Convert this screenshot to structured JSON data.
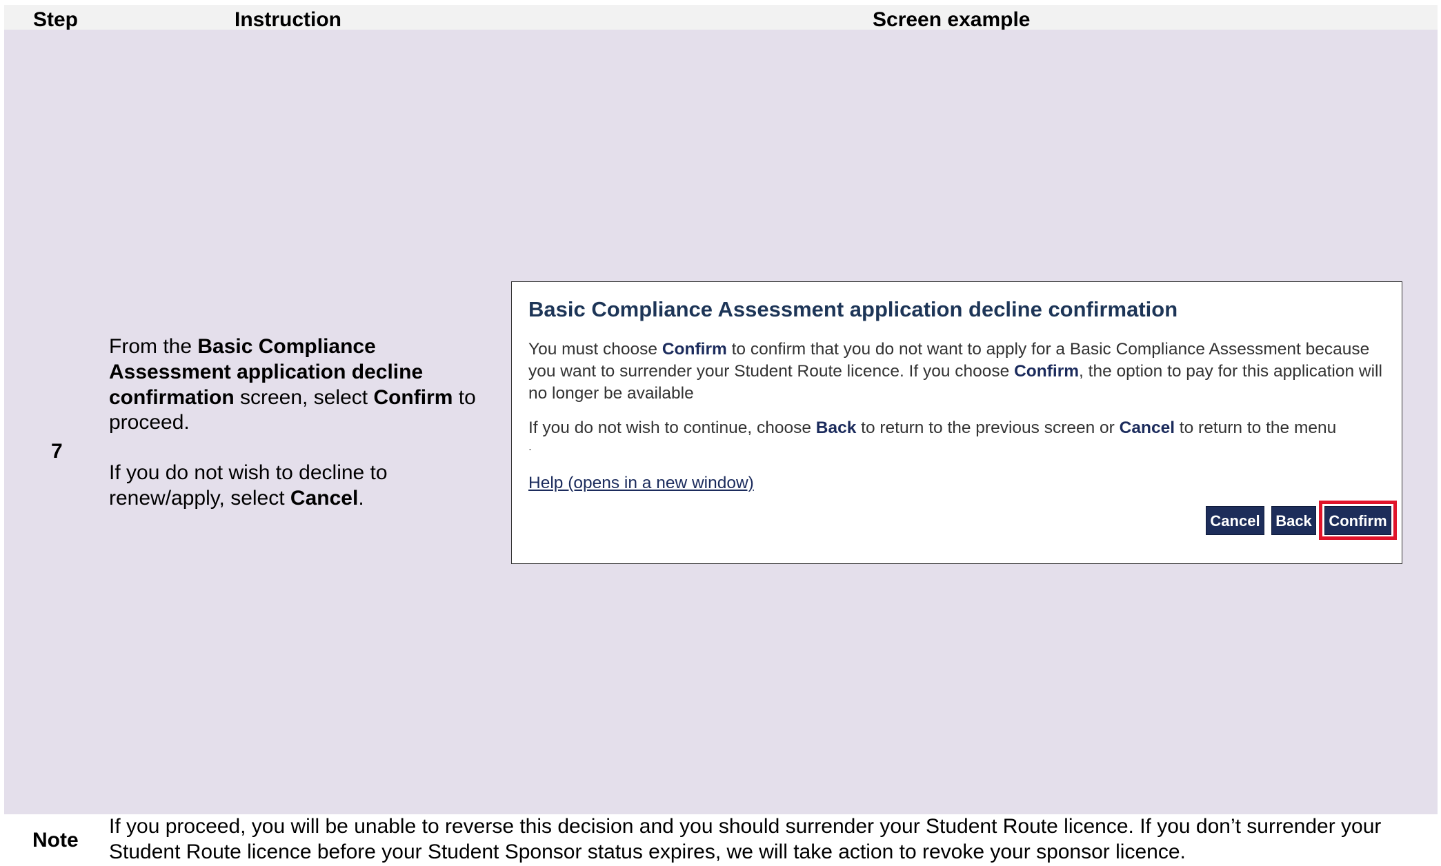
{
  "table": {
    "headers": {
      "step": "Step",
      "instruction": "Instruction",
      "screen": "Screen example"
    }
  },
  "row": {
    "step_number": "7",
    "instruction": {
      "p1_prefix": "From the ",
      "p1_bold": "Basic Compliance Assessment application decline confirmation",
      "p1_mid": " screen, select ",
      "p1_bold2": "Confirm",
      "p1_suffix": " to proceed.",
      "p2_prefix": "If you do not wish to decline to renew/apply, select ",
      "p2_bold": "Cancel",
      "p2_suffix": "."
    }
  },
  "dialog": {
    "title": "Basic Compliance Assessment application decline confirmation",
    "p1_a": "You must choose ",
    "p1_b": "Confirm",
    "p1_c": " to confirm that you do not want to apply for a Basic Compliance Assessment because you want to surrender your Student Route licence. If you choose ",
    "p1_d": "Confirm",
    "p1_e": ", the option to pay for this application will no longer be available",
    "p2_a": "If you do not wish to continue, choose ",
    "p2_b": "Back",
    "p2_c": " to return to the previous screen or ",
    "p2_d": "Cancel",
    "p2_e": " to return to the menu",
    "dot": ".",
    "help_link": "Help (opens in a new window)",
    "buttons": {
      "cancel": "Cancel",
      "back": "Back",
      "confirm": "Confirm"
    },
    "highlight_color": "#e0142a",
    "button_color": "#1d2d5a"
  },
  "note": {
    "label": "Note",
    "text": "If you proceed, you will be unable to reverse this decision and you should surrender your Student Route licence. If you don’t surrender your Student Route licence before your Student Sponsor status expires, we will take action to revoke your sponsor licence."
  }
}
